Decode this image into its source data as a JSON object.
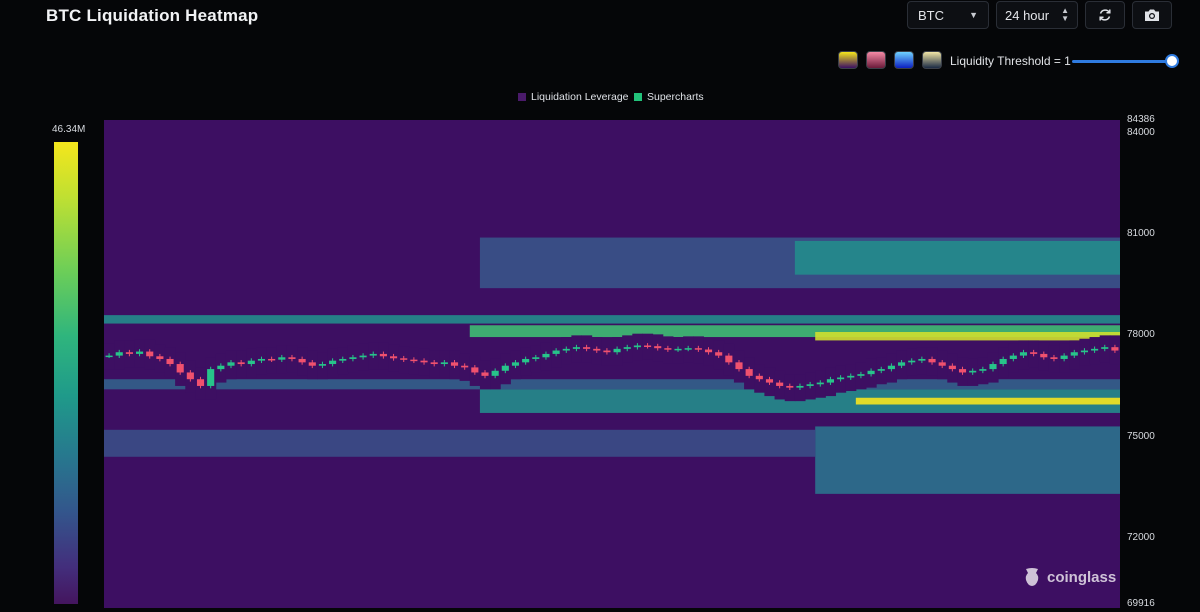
{
  "header": {
    "title": "BTC Liquidation Heatmap",
    "symbol_value": "BTC",
    "range_value": "24 hour"
  },
  "toolbar": {
    "refresh_icon": "refresh-icon",
    "camera_icon": "camera-icon"
  },
  "palettes": [
    {
      "name": "viridis",
      "from": "#f4e61c",
      "to": "#3b0f63"
    },
    {
      "name": "rose",
      "from": "#f58aa6",
      "to": "#6b1a3a"
    },
    {
      "name": "blue",
      "from": "#6fd2ff",
      "to": "#0b1fc2"
    },
    {
      "name": "cream",
      "from": "#f2e6a6",
      "to": "#1b2a44"
    }
  ],
  "threshold": {
    "label": "Liquidity Threshold = 1",
    "value_fraction": 1.0
  },
  "legend": {
    "leverage_label": "Liquidation Leverage",
    "leverage_color": "#4a1a6a",
    "supercharts_label": "Supercharts",
    "supercharts_color": "#22c27a"
  },
  "color_scale": {
    "max_label": "46.34M"
  },
  "watermark": {
    "text": "coinglass"
  },
  "chart_data": {
    "type": "heatmap",
    "title": "BTC Liquidation Heatmap",
    "ylim": [
      69916,
      84386
    ],
    "y_ticks": [
      {
        "value": 84386,
        "label": "84386"
      },
      {
        "value": 84000,
        "label": "84000"
      },
      {
        "value": 81000,
        "label": "81000"
      },
      {
        "value": 78000,
        "label": "78000"
      },
      {
        "value": 75000,
        "label": "75000"
      },
      {
        "value": 72000,
        "label": "72000"
      },
      {
        "value": 69916,
        "label": "69916"
      }
    ],
    "x_steps": 1016,
    "colors": {
      "background": "#3d0f62",
      "up": "#27c48a",
      "down": "#f0516e"
    },
    "bands": [
      {
        "low": 79400,
        "high": 80900,
        "x_start": 0.37,
        "x_end": 1.0,
        "intensity": 0.3
      },
      {
        "low": 79800,
        "high": 80800,
        "x_start": 0.68,
        "x_end": 1.0,
        "intensity": 0.55
      },
      {
        "low": 78350,
        "high": 78600,
        "x_start": 0.0,
        "x_end": 1.0,
        "intensity": 0.55
      },
      {
        "low": 77950,
        "high": 78300,
        "x_start": 0.36,
        "x_end": 1.0,
        "intensity": 0.75
      },
      {
        "low": 77850,
        "high": 78100,
        "x_start": 0.7,
        "x_end": 1.0,
        "intensity": 0.95
      },
      {
        "low": 76400,
        "high": 76700,
        "x_start": 0.0,
        "x_end": 1.0,
        "intensity": 0.35
      },
      {
        "low": 75700,
        "high": 76400,
        "x_start": 0.37,
        "x_end": 1.0,
        "intensity": 0.55
      },
      {
        "low": 75950,
        "high": 76150,
        "x_start": 0.74,
        "x_end": 1.0,
        "intensity": 1.0
      },
      {
        "low": 73300,
        "high": 75300,
        "x_start": 0.7,
        "x_end": 1.0,
        "intensity": 0.42
      },
      {
        "low": 74400,
        "high": 75200,
        "x_start": 0.0,
        "x_end": 0.7,
        "intensity": 0.28
      }
    ],
    "candles_close": [
      77400,
      77500,
      77450,
      77520,
      77380,
      77300,
      77150,
      76900,
      76700,
      76500,
      77000,
      77100,
      77200,
      77150,
      77250,
      77300,
      77280,
      77350,
      77300,
      77200,
      77100,
      77150,
      77250,
      77300,
      77350,
      77400,
      77450,
      77380,
      77320,
      77280,
      77250,
      77200,
      77150,
      77200,
      77100,
      77050,
      76900,
      76800,
      76950,
      77100,
      77200,
      77300,
      77350,
      77450,
      77550,
      77600,
      77650,
      77600,
      77550,
      77500,
      77600,
      77650,
      77700,
      77680,
      77620,
      77580,
      77600,
      77620,
      77580,
      77500,
      77400,
      77200,
      77000,
      76800,
      76700,
      76600,
      76500,
      76450,
      76500,
      76550,
      76600,
      76700,
      76750,
      76800,
      76850,
      76950,
      77000,
      77100,
      77200,
      77250,
      77300,
      77200,
      77100,
      77000,
      76900,
      76950,
      77000,
      77150,
      77300,
      77400,
      77500,
      77450,
      77350,
      77300,
      77400,
      77500,
      77550,
      77600,
      77650,
      77550
    ],
    "liq_gap": {
      "upper_offset": 350,
      "lower_offset": 400
    }
  }
}
